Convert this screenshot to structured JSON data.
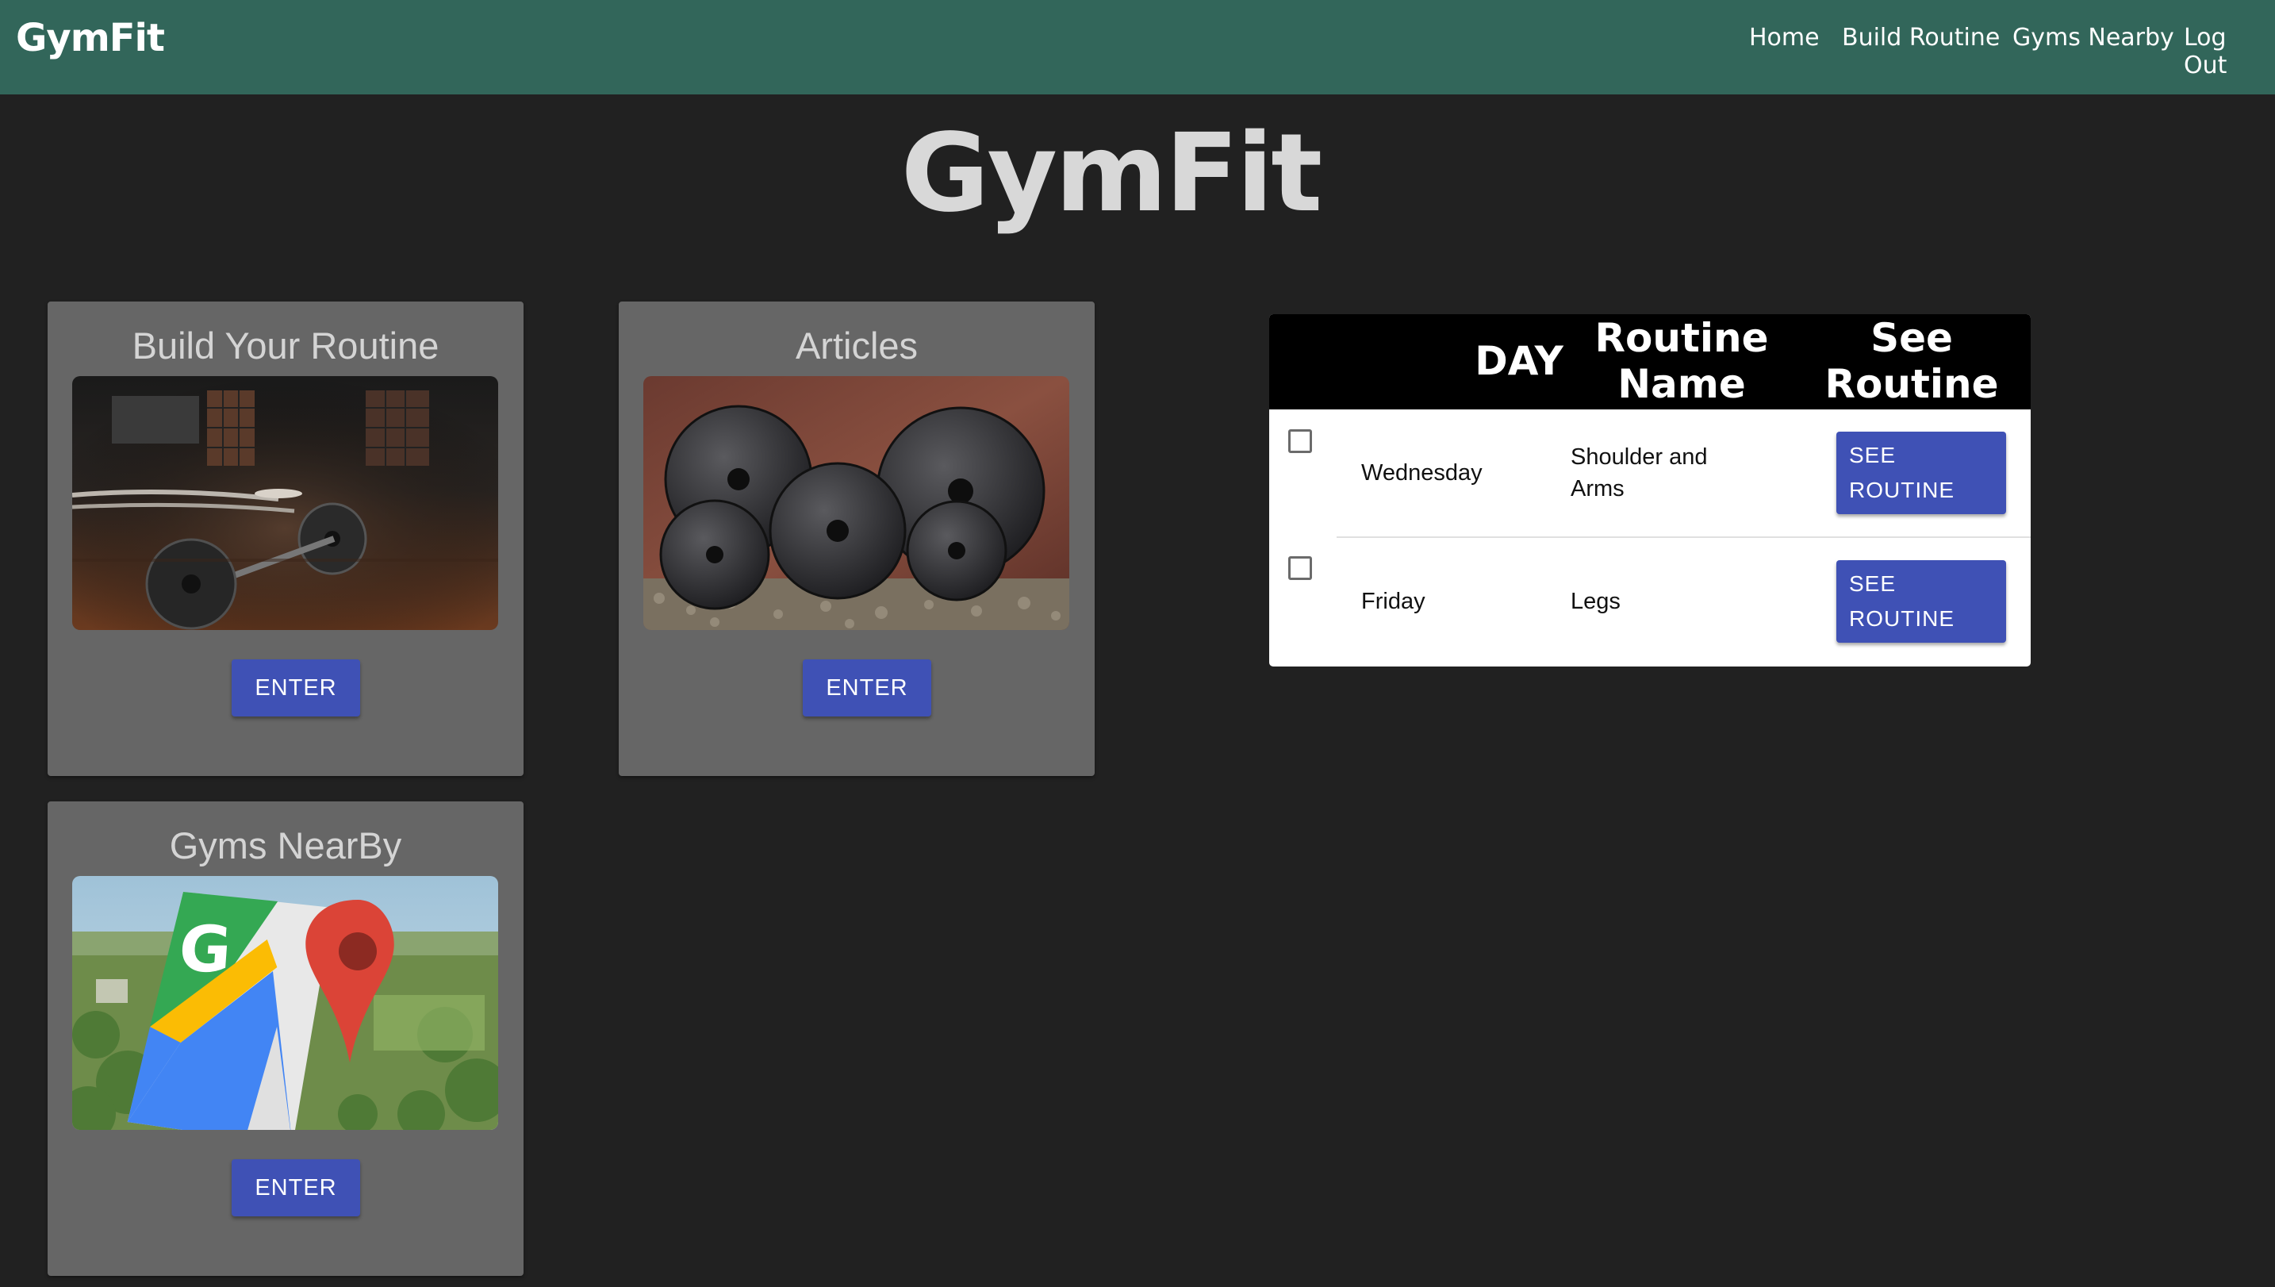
{
  "navbar": {
    "brand": "GymFit",
    "links": [
      "Home",
      "Build Routine",
      "Gyms Nearby",
      "Log Out"
    ]
  },
  "hero": {
    "title": "GymFit"
  },
  "cards": [
    {
      "title": "Build Your Routine",
      "button": "ENTER",
      "image": "barbell-gym-photo"
    },
    {
      "title": "Articles",
      "button": "ENTER",
      "image": "weight-plates-photo"
    },
    {
      "title": "Gyms NearBy",
      "button": "ENTER",
      "image": "google-maps-landscape-photo"
    }
  ],
  "routine_table": {
    "headers": [
      "DAY",
      "Routine Name",
      "See Routine"
    ],
    "rows": [
      {
        "day": "Wednesday",
        "routine_name": "Shoulder and Arms",
        "button": "SEE ROUTINE",
        "checked": false
      },
      {
        "day": "Friday",
        "routine_name": "Legs",
        "button": "SEE ROUTINE",
        "checked": false
      }
    ]
  },
  "colors": {
    "navbar": "#32665a",
    "background": "#212121",
    "card": "#666666",
    "button": "#3f51b5"
  }
}
